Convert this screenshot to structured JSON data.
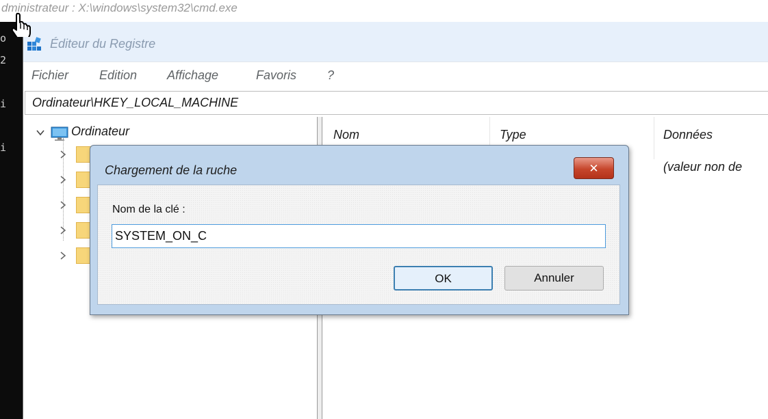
{
  "cmd_window": {
    "title": "dministrateur : X:\\windows\\system32\\cmd.exe",
    "visible_chars": [
      "o",
      "2",
      "i",
      "i"
    ]
  },
  "regedit": {
    "title": "Éditeur du Registre",
    "menu": [
      "Fichier",
      "Edition",
      "Affichage",
      "Favoris",
      "?"
    ],
    "address": "Ordinateur\\HKEY_LOCAL_MACHINE",
    "tree": {
      "root_label": "Ordinateur",
      "child_count": 5
    },
    "list": {
      "columns": [
        "Nom",
        "Type",
        "Données"
      ],
      "rows": [
        {
          "nom": "",
          "type": "",
          "donnees": "(valeur non de"
        }
      ]
    }
  },
  "dialog": {
    "title": "Chargement de la ruche",
    "close_label": "✕",
    "field_label": "Nom de la clé :",
    "field_value": "SYSTEM_ON_C",
    "ok_label": "OK",
    "cancel_label": "Annuler"
  },
  "colors": {
    "titlebar": "#e7f0fb",
    "dialog_frame": "#bfd5ec",
    "close_red": "#c6462c",
    "ok_border": "#3c7fb1",
    "input_border": "#4c9bdd"
  },
  "icons": {
    "app": "regedit-icon",
    "cursor": "hand-pointer-icon",
    "root": "computer-monitor-icon",
    "folders": "folder-icon",
    "expand": "chevron-down-icon",
    "collapsed": "chevron-right-icon"
  }
}
